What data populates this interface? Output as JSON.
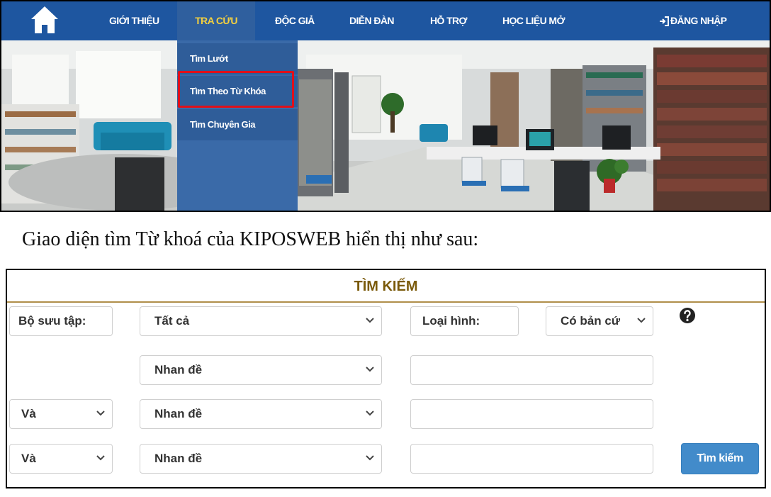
{
  "nav": {
    "items": [
      {
        "label": "GIỚI THIỆU"
      },
      {
        "label": "TRA CỨU"
      },
      {
        "label": "ĐỘC GIẢ"
      },
      {
        "label": "DIỄN ĐÀN"
      },
      {
        "label": "HỖ TRỢ"
      },
      {
        "label": "HỌC LIỆU MỞ"
      }
    ],
    "login_label": "ĐĂNG NHẬP",
    "bg_color": "#1e56a0",
    "active_color": "#f4d03f"
  },
  "dropdown": {
    "items": [
      {
        "label": "Tìm Lướt"
      },
      {
        "label": "Tìm Theo Từ Khóa"
      },
      {
        "label": "Tìm Chuyên Gia"
      }
    ],
    "highlight_color": "#e0101a"
  },
  "caption": "Giao diện tìm Từ khoá của KIPOSWEB hiển thị như sau:",
  "form": {
    "title": "TÌM KIẾM",
    "collection_label": "Bộ sưu tập:",
    "collection_value": "Tất cả",
    "type_label": "Loại hình:",
    "type_value": "Có bản cứ",
    "rows": [
      {
        "field": "Nhan đề",
        "value": ""
      },
      {
        "operator": "Và",
        "field": "Nhan đề",
        "value": ""
      },
      {
        "operator": "Và",
        "field": "Nhan đề",
        "value": ""
      }
    ],
    "search_button": "Tìm kiếm",
    "button_color": "#428bca"
  }
}
